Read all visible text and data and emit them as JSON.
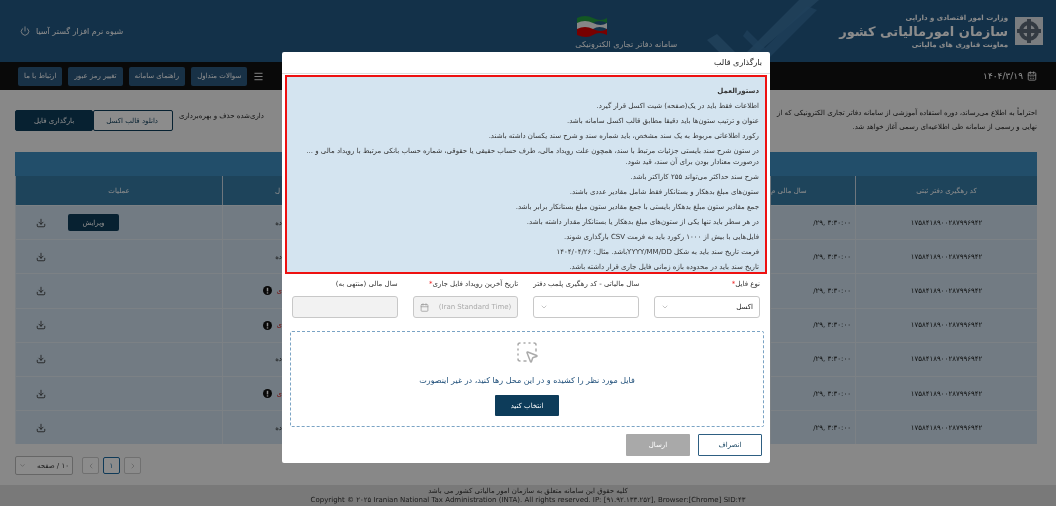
{
  "header": {
    "ministry": "وزارت امور اقتصادی و دارایی",
    "organization": "سازمان امورمالیاتی کشور",
    "deputy": "معاونت فناوری های مالیاتی",
    "system_name": "سامانه دفاتر تجاری الکترونیکی",
    "company": "شیوه نرم افزار گستر آسیا"
  },
  "nav": {
    "date": "۱۴۰۴/۳/۱۹",
    "buttons": [
      "سوالات متداول",
      "راهنمای سامانه",
      "تغییر رمز عبور",
      "ارتباط با ما"
    ]
  },
  "notice": {
    "lines": [
      "احتراماً به اطلاع می‌رساند، دوره استفاده آموزشی از سامانه دفاتر تجاری الکترونیکی که از",
      "نهایی و رسمی از سامانه طی اطلاعیه‌ای رسمی آغاز خواهد شد."
    ],
    "left_fragment": "داری‌شده حذف و بهره‌برداری"
  },
  "actions": [
    {
      "label": "دانلود قالب اکسل",
      "kind": "outline"
    },
    {
      "label": "بارگذاری فایل",
      "kind": "primary"
    }
  ],
  "table": {
    "columns": [
      "کد رهگیری دفتر ثبتی",
      "سال مالی م",
      "ل",
      "عملیات"
    ],
    "rows": [
      {
        "code": "۱۷۵۸۴۱۸۹۰۰۲۸۷۹۹۶۹۴۲",
        "year": "/۲۹, ۳:۳۰:۰۰",
        "status": "ده",
        "kind": "ok",
        "edit": "ویرایش"
      },
      {
        "code": "۱۷۵۸۴۱۸۹۰۰۲۸۷۹۹۶۹۴۲",
        "year": "/۲۹, ۳:۳۰:۰۰",
        "status": "ده",
        "kind": "ok"
      },
      {
        "code": "۱۷۵۸۴۱۸۹۰۰۲۸۷۹۹۶۹۴۲",
        "year": "/۲۹, ۳:۳۰:۰۰",
        "status": "ی",
        "kind": "error"
      },
      {
        "code": "۱۷۵۸۴۱۸۹۰۰۲۸۷۹۹۶۹۴۲",
        "year": "/۲۹, ۳:۳۰:۰۰",
        "status": "ی",
        "kind": "error"
      },
      {
        "code": "۱۷۵۸۴۱۸۹۰۰۲۸۷۹۹۶۹۴۲",
        "year": "/۲۹, ۳:۳۰:۰۰",
        "status": "ده",
        "kind": "ok"
      },
      {
        "code": "۱۷۵۸۴۱۸۹۰۰۲۸۷۹۹۶۹۴۲",
        "year": "/۲۹, ۳:۳۰:۰۰",
        "status": "ی",
        "kind": "error"
      },
      {
        "code": "۱۷۵۸۴۱۸۹۰۰۲۸۷۹۹۶۹۴۲",
        "year": "/۲۹, ۳:۳۰:۰۰",
        "status": "ده",
        "kind": "ok"
      }
    ]
  },
  "pagination": {
    "page_size": "۱۰ / صفحه",
    "pages": [
      {
        "label": "۱",
        "selected": true
      }
    ]
  },
  "footer": {
    "rights": "کلیه حقوق این سامانه متعلق به سازمان امور مالیاتی کشور می باشد",
    "copyright": "Copyright © ۲۰۲۵ Iranian National Tax Administration (INTA). All rights reserved. IP: [۹۱.۹۲.۱۳۳.۲۵۲], Browser:[Chrome] SID:۴۳"
  },
  "modal": {
    "title": "بارگذاری قالب",
    "instructions": {
      "title": "دستورالعمل",
      "items": [
        "اطلاعات فقط باید در یک(صفحه) شیت اکسل قرار گیرد.",
        "عنوان و ترتیب ستون‌ها باید دقیقا مطابق قالب اکسل سامانه باشد.",
        "رکورد اطلاعاتی مربوط به یک سند مشخص، باید شماره سند و شرح سند یکسان داشته باشند.",
        "در ستون شرح سند بایستی جزئیات مرتبط با سند، همچون علت رویداد مالی، طرف حساب حقیقی یا حقوقی، شماره حساب بانکی مرتبط با رویداد مالی و ... درصورت معنادار بودن برای آن سند، قید شود.",
        "شرح سند حداکثر می‌تواند ۲۵۵ کاراکتر باشد.",
        "ستون‌های مبلغ بدهکار و بستانکار فقط شامل مقادیر عددی باشند.",
        "جمع مقادیر ستون مبلغ بدهکار بایستی با جمع مقادیر ستون مبلغ بستانکار برابر باشد.",
        "در هر سطر باید تنها یکی از ستون‌های مبلغ بدهکار یا بستانکار مقدار داشته باشد.",
        "فایل‌هایی با بیش از ۱۰۰۰ رکورد باید به فرمت CSV بارگذاری شوند.",
        "فرمت تاریخ سند باید به شکل YYYY/MM/DDباشد. مثال: ۱۴۰۴/۰۴/۲۶",
        "تاریخ سند باید در محدوده بازه زمانی فایل جاری قرار داشته باشد."
      ]
    },
    "fields": [
      {
        "label": "نوع فایل",
        "required": true,
        "kind": "select",
        "value": "اکسل",
        "disabled": false
      },
      {
        "label": "سال مالیاتی - کد رهگیری پلمب دفتر",
        "required": false,
        "kind": "select",
        "disabled": false
      },
      {
        "label": "تاریخ آخرین رویداد فایل جاری",
        "required": true,
        "kind": "date",
        "value": "(Iran Standard Time)",
        "disabled": true
      },
      {
        "label": "سال مالی (منتهی به)",
        "required": false,
        "kind": "text",
        "disabled": true
      }
    ],
    "required_mark": "*",
    "dropzone": {
      "text": "فایل مورد نظر را کشیده و در این محل رها کنید، در غیر اینصورت",
      "button": "انتخاب کنید"
    },
    "buttons": [
      {
        "label": "انصراف",
        "kind": "outline",
        "disabled": false
      },
      {
        "label": "ارسال",
        "kind": "submit",
        "disabled": true
      }
    ]
  }
}
